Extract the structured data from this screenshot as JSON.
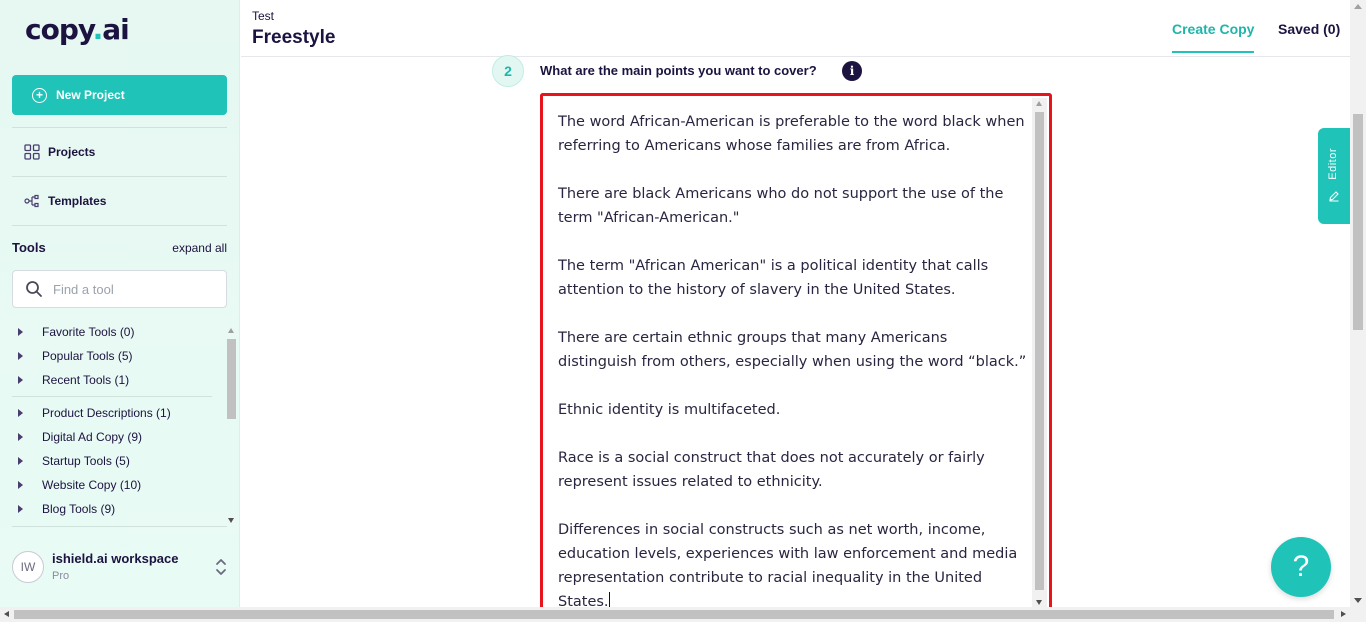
{
  "brand": {
    "logo_part1": "copy",
    "logo_dot": ".",
    "logo_part2": "ai"
  },
  "sidebar": {
    "new_project_label": "New Project",
    "nav": [
      {
        "label": "Projects",
        "icon": "grid-icon"
      },
      {
        "label": "Templates",
        "icon": "templates-icon"
      }
    ],
    "tools_title": "Tools",
    "expand_all": "expand all",
    "search_placeholder": "Find a tool",
    "tool_groups": [
      {
        "label": "Favorite Tools (0)"
      },
      {
        "label": "Popular Tools (5)"
      },
      {
        "label": "Recent Tools (1)"
      },
      {
        "label": "Product Descriptions (1)"
      },
      {
        "label": "Digital Ad Copy (9)"
      },
      {
        "label": "Startup Tools (5)"
      },
      {
        "label": "Website Copy (10)"
      },
      {
        "label": "Blog Tools (9)"
      }
    ],
    "workspace": {
      "initials": "IW",
      "name": "ishield.ai workspace",
      "plan": "Pro"
    }
  },
  "header": {
    "breadcrumb": "Test",
    "title": "Freestyle",
    "tabs": [
      {
        "label": "Create Copy",
        "active": true
      },
      {
        "label": "Saved (0)",
        "active": false
      }
    ]
  },
  "form": {
    "step_number": "2",
    "question": "What are the main points you want to cover?",
    "info_icon_glyph": "i",
    "paragraphs": [
      "The word African-American is preferable to the word black when referring to Americans whose families are from Africa.",
      "There are black Americans who do not support the use of the term \"African-American.\"",
      "The term \"African American\" is a political identity that calls attention to the history of slavery in the United States.",
      "There are certain ethnic groups that many Americans distinguish from others, especially when using the word “black.”",
      "Ethnic identity is multifaceted.",
      "Race is a social construct that does not accurately or fairly represent issues related to ethnicity.",
      "Differences in social constructs such as net worth, income, education levels, experiences with law enforcement and media representation contribute to racial inequality in the United States."
    ]
  },
  "editor_tab_label": "Editor",
  "help_button_label": "?",
  "colors": {
    "accent": "#1fc3b7",
    "highlight_border": "#e8141b",
    "text_dark": "#1c1340"
  }
}
